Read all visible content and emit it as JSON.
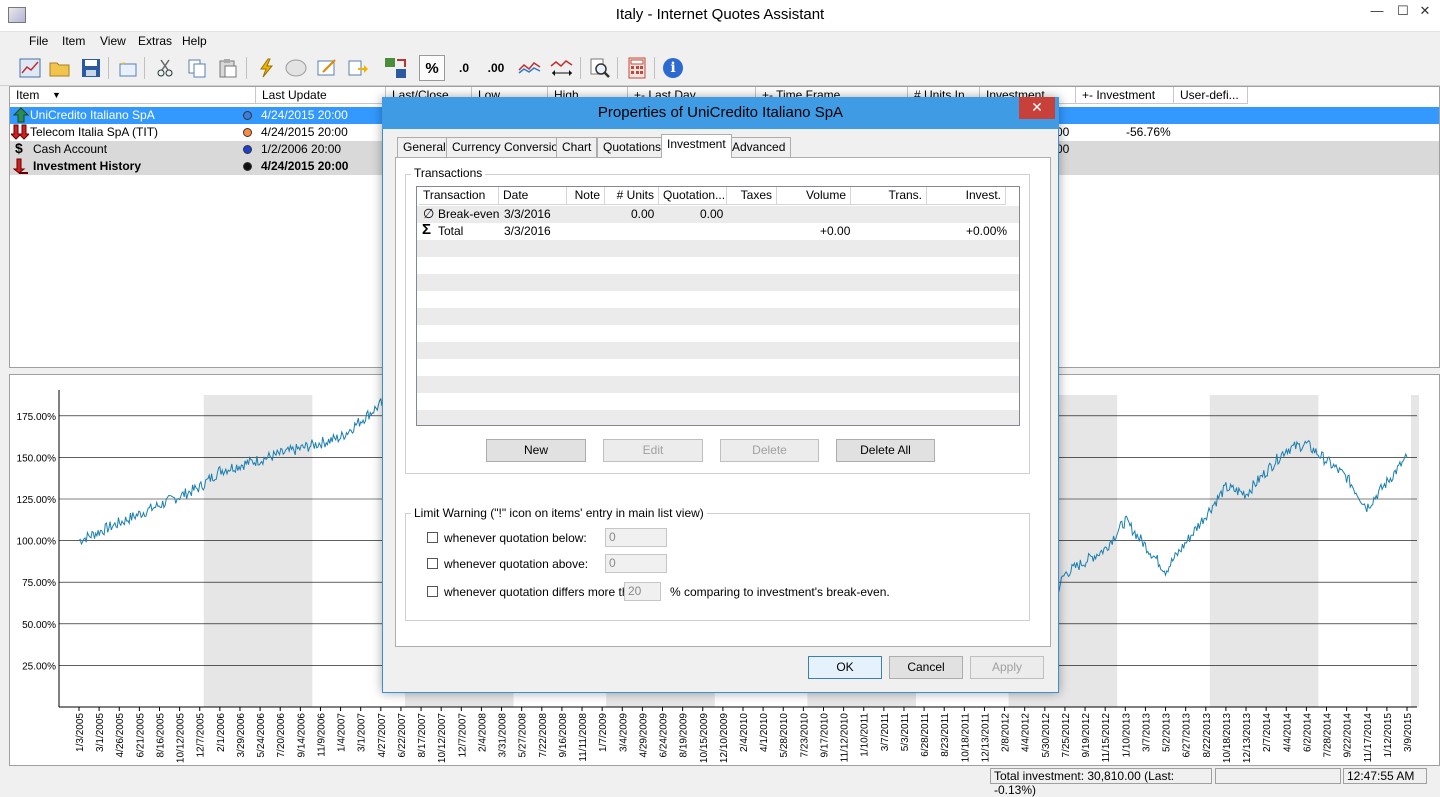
{
  "window": {
    "title": "Italy - Internet Quotes Assistant",
    "minimize": "—",
    "maximize": "☐",
    "close": "✕"
  },
  "menu": [
    "File",
    "Item",
    "View",
    "Extras",
    "Help"
  ],
  "toolbar_icons": [
    "chart-icon",
    "folder-open-icon",
    "save-icon",
    "new-item-icon",
    "cut-icon",
    "copy-icon",
    "paste-icon",
    "update-icon",
    "stop-icon",
    "edit-icon",
    "export-icon",
    "compare-icon",
    "percent-icon",
    "decimal-increase-icon",
    "decimal-decrease-icon",
    "lines-icon",
    "range-icon",
    "search-icon",
    "calculator-icon",
    "info-icon"
  ],
  "toolbar_glyphs": {
    "percent": "%",
    "dec_inc": ".0",
    "dec_dec": ".00",
    "info": "i"
  },
  "list": {
    "columns": [
      "Item",
      "Last Update",
      "Last/Close",
      "Low",
      "High",
      "+- Last Day",
      "+- Time Frame",
      "# Units In",
      "Investment",
      "+- Investment",
      "User-defi..."
    ],
    "rows": [
      {
        "name": "UniCredito Italiano SpA",
        "update": "4/24/2015   20:00",
        "icon": "arrow-up-icon",
        "dot": "#3b7dd8",
        "extra1": "",
        "extra2": ""
      },
      {
        "name": "Telecom Italia SpA (TIT)",
        "update": "4/24/2015   20:00",
        "icon": "arrow-down-icon",
        "dot": "#ff8a3d",
        "extra1": "00",
        "extra2": "-56.76%"
      },
      {
        "name": "Cash Account",
        "update": "1/2/2006   20:00",
        "icon": "dollar-icon",
        "dot": "#1f3fd0",
        "extra1": "00",
        "extra2": ""
      },
      {
        "name": "Investment History",
        "update": "4/24/2015   20:00",
        "icon": "history-icon",
        "dot": "#111111",
        "extra1": "",
        "extra2": ""
      }
    ]
  },
  "chart_data": {
    "type": "line",
    "y_ticks": [
      "175.00%",
      "150.00%",
      "125.00%",
      "100.00%",
      "75.00%",
      "50.00%",
      "25.00%"
    ],
    "ylim": [
      0,
      187.5
    ],
    "x_ticks": [
      "1/3/2005",
      "3/1/2005",
      "4/26/2005",
      "6/21/2005",
      "8/16/2005",
      "10/12/2005",
      "12/7/2005",
      "2/1/2006",
      "3/29/2006",
      "5/24/2006",
      "7/20/2006",
      "9/14/2006",
      "11/9/2006",
      "1/4/2007",
      "3/1/2007",
      "4/27/2007",
      "6/22/2007",
      "8/17/2007",
      "10/12/2007",
      "12/7/2007",
      "2/4/2008",
      "3/31/2008",
      "5/27/2008",
      "7/22/2008",
      "9/16/2008",
      "11/11/2008",
      "1/7/2009",
      "3/4/2009",
      "4/29/2009",
      "6/24/2009",
      "8/19/2009",
      "10/15/2009",
      "12/10/2009",
      "2/4/2010",
      "4/1/2010",
      "5/28/2010",
      "7/23/2010",
      "9/17/2010",
      "11/12/2010",
      "1/10/2011",
      "3/7/2011",
      "5/3/2011",
      "6/28/2011",
      "8/23/2011",
      "10/18/2011",
      "12/13/2011",
      "2/8/2012",
      "4/4/2012",
      "5/30/2012",
      "7/25/2012",
      "9/19/2012",
      "11/15/2012",
      "1/10/2013",
      "3/7/2013",
      "5/2/2013",
      "6/27/2013",
      "8/22/2013",
      "10/18/2013",
      "12/13/2013",
      "2/7/2014",
      "4/4/2014",
      "6/2/2014",
      "7/28/2014",
      "9/22/2014",
      "11/17/2014",
      "1/12/2015",
      "3/9/2015"
    ],
    "series": [
      {
        "x": [
          "1/3/2005",
          "12/7/2005",
          "2/1/2006",
          "1/4/2007",
          "4/27/2007",
          "6/22/2007"
        ],
        "y": [
          100,
          132,
          142,
          162,
          182,
          178
        ]
      },
      {
        "x": [
          "5/30/2012",
          "7/25/2012",
          "11/15/2012",
          "1/10/2013",
          "5/2/2013",
          "10/18/2013",
          "12/13/2013",
          "4/4/2014",
          "6/2/2014",
          "9/22/2014",
          "11/17/2014",
          "3/9/2015"
        ],
        "y": [
          55,
          80,
          95,
          112,
          82,
          132,
          128,
          155,
          158,
          138,
          120,
          150
        ]
      }
    ],
    "colors": {
      "line": "#1a7fb0",
      "band": "#e6e6e6",
      "grid": "#000000"
    }
  },
  "status": {
    "investment": "Total investment: 30,810.00 (Last: -0.13%)",
    "time": "12:47:55 AM"
  },
  "dialog": {
    "title": "Properties of UniCredito Italiano SpA",
    "close": "✕",
    "tabs": [
      "General",
      "Currency Conversion",
      "Chart",
      "Quotations",
      "Investment",
      "Advanced"
    ],
    "active_tab": "Investment",
    "transactions": {
      "group_title": "Transactions",
      "columns": [
        "Transaction",
        "Date",
        "Note",
        "# Units",
        "Quotation...",
        "Taxes",
        "Volume",
        "Trans. Result",
        "Invest. Result"
      ],
      "rows": [
        {
          "symbol": "∅",
          "transaction": "Break-even",
          "date": "3/3/2016",
          "note": "",
          "units": "0.00",
          "quotation": "0.00",
          "taxes": "",
          "volume": "",
          "trans_result": "",
          "invest_result": ""
        },
        {
          "symbol": "Σ",
          "transaction": "Total",
          "date": "3/3/2016",
          "note": "",
          "units": "",
          "quotation": "",
          "taxes": "",
          "volume": "+0.00",
          "trans_result": "",
          "invest_result": "+0.00%"
        }
      ],
      "buttons": {
        "new": "New",
        "edit": "Edit",
        "delete": "Delete",
        "delete_all": "Delete All"
      }
    },
    "limit": {
      "group_title": "Limit Warning (\"!\" icon on items' entry in main list view)",
      "below_label": "whenever quotation below:",
      "below_value": "0",
      "above_label": "whenever quotation above:",
      "above_value": "0",
      "differs_label": "whenever quotation differs more than",
      "differs_value": "20",
      "differs_suffix": "% comparing to investment's break-even."
    },
    "buttons": {
      "ok": "OK",
      "cancel": "Cancel",
      "apply": "Apply"
    }
  }
}
